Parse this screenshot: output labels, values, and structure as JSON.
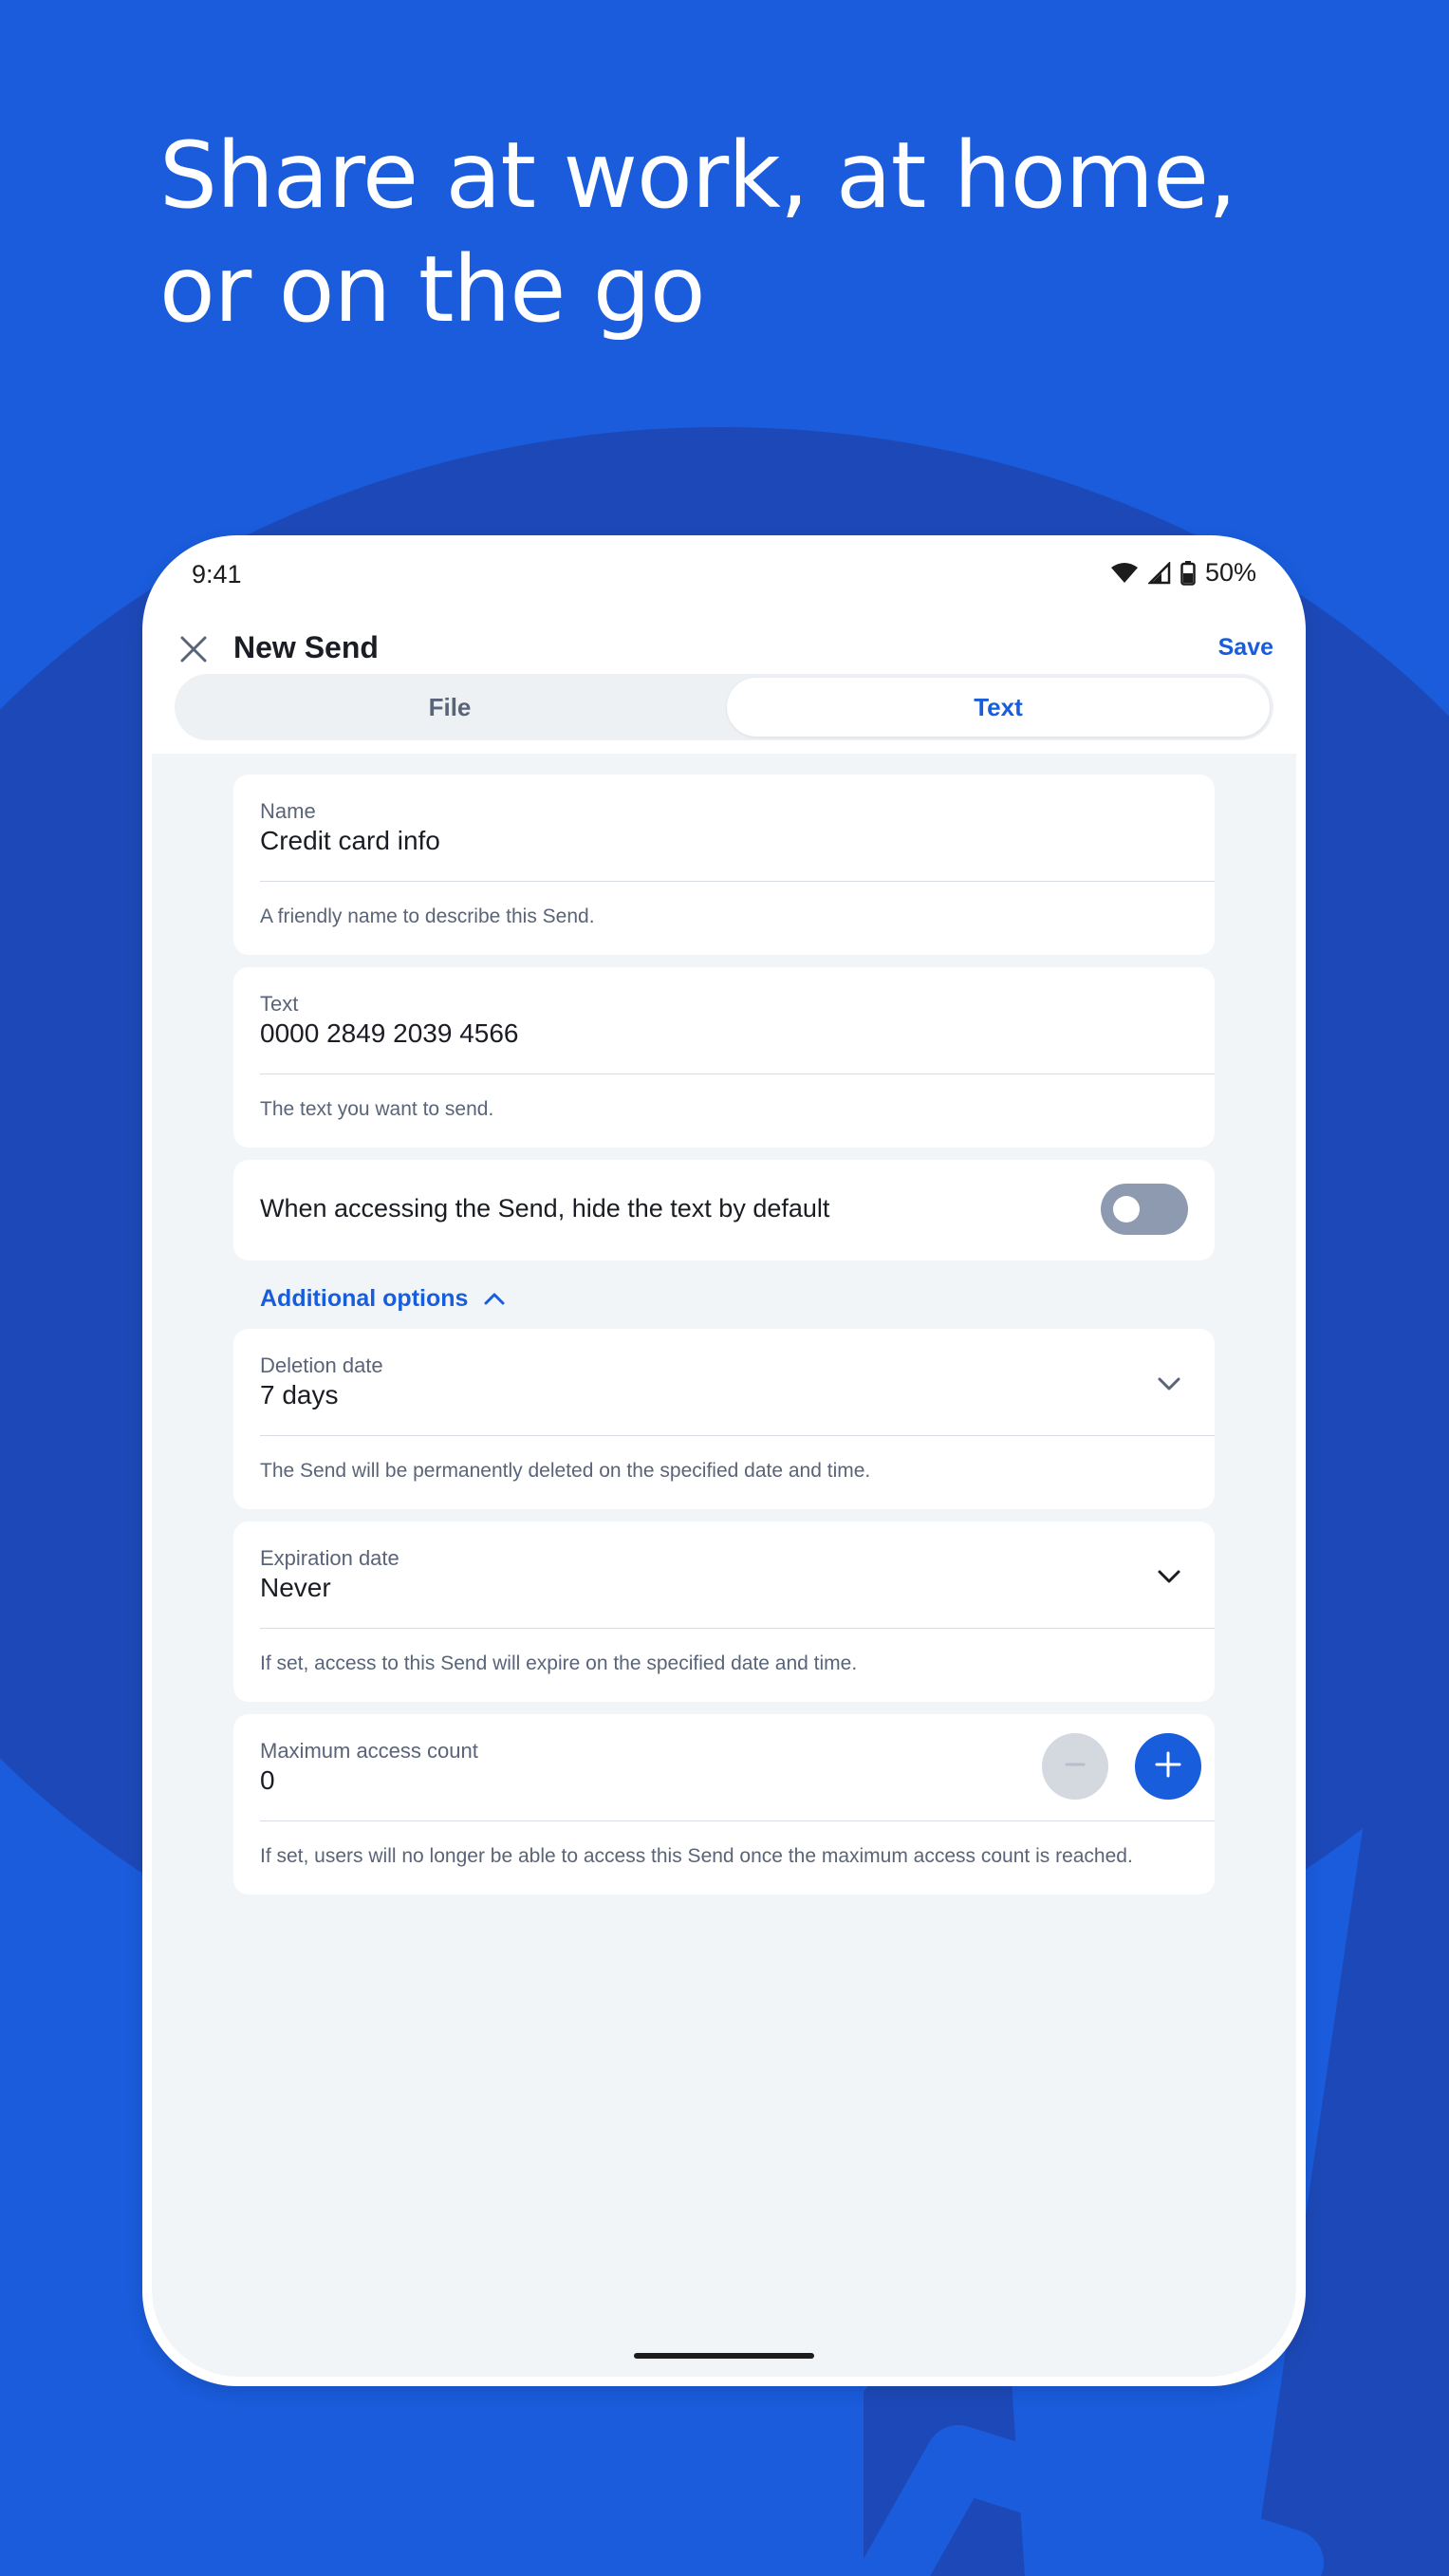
{
  "headline": {
    "line1": "Share at work, at home,",
    "line2": "or on the go"
  },
  "status_bar": {
    "time": "9:41",
    "battery": "50%"
  },
  "app_bar": {
    "title": "New Send",
    "save_label": "Save"
  },
  "tabs": {
    "file_label": "File",
    "text_label": "Text",
    "selected": "Text"
  },
  "name_field": {
    "label": "Name",
    "value": "Credit card info",
    "help": "A friendly name to describe this Send."
  },
  "text_field": {
    "label": "Text",
    "value": "0000 2849 2039 4566",
    "help": "The text you want to send."
  },
  "hide_text_toggle": {
    "label": "When accessing the Send, hide the text by default",
    "on": false
  },
  "additional_options": {
    "label": "Additional options"
  },
  "deletion_date": {
    "label": "Deletion date",
    "value": "7 days",
    "help": "The Send will be permanently deleted on the specified date and time."
  },
  "expiration_date": {
    "label": "Expiration date",
    "value": "Never",
    "help": "If set, access to this Send will expire on the specified date and time."
  },
  "max_access": {
    "label": "Maximum access count",
    "value": "0",
    "help": "If set, users will no longer be able to access this Send once the maximum access count is reached."
  },
  "colors": {
    "background": "#1a5cdc",
    "accent": "#175ddc",
    "toggle_off": "#8e9aaf"
  },
  "icons": {
    "close": "close-icon",
    "wifi": "wifi-icon",
    "signal": "signal-icon",
    "battery": "battery-icon",
    "chevron_up": "chevron-up-icon",
    "chevron_down": "chevron-down-icon",
    "minus": "minus-icon",
    "plus": "plus-icon"
  }
}
